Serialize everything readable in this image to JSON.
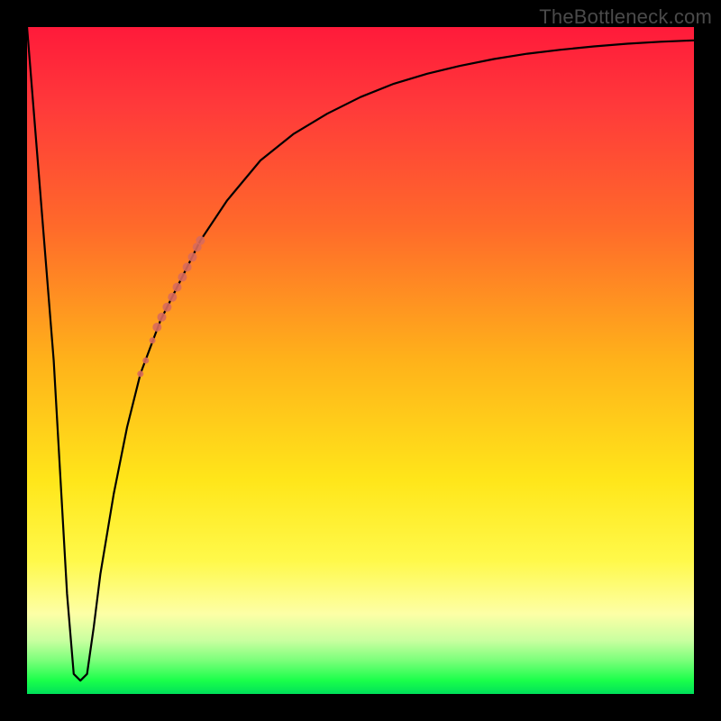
{
  "watermark": "TheBottleneck.com",
  "chart_data": {
    "type": "line",
    "title": "",
    "xlabel": "",
    "ylabel": "",
    "xlim": [
      0,
      100
    ],
    "ylim": [
      0,
      100
    ],
    "grid": false,
    "legend": false,
    "series": [
      {
        "name": "bottleneck-curve",
        "x": [
          0,
          4,
          6,
          7,
          8,
          9,
          10,
          11,
          13,
          15,
          17,
          20,
          23,
          26,
          30,
          35,
          40,
          45,
          50,
          55,
          60,
          65,
          70,
          75,
          80,
          85,
          90,
          95,
          100
        ],
        "y": [
          100,
          50,
          15,
          3,
          2,
          3,
          10,
          18,
          30,
          40,
          48,
          56,
          62,
          68,
          74,
          80,
          84,
          87,
          89.5,
          91.5,
          93,
          94.2,
          95.2,
          96,
          96.6,
          97.1,
          97.5,
          97.8,
          98
        ]
      }
    ],
    "overlay_points": {
      "name": "highlight-segment",
      "color": "#d86a5c",
      "points": [
        {
          "x": 17.0,
          "y": 48.0,
          "r": 3.5
        },
        {
          "x": 17.8,
          "y": 50.0,
          "r": 3.5
        },
        {
          "x": 18.8,
          "y": 53.0,
          "r": 3.5
        },
        {
          "x": 19.5,
          "y": 55.0,
          "r": 5.0
        },
        {
          "x": 20.2,
          "y": 56.5,
          "r": 5.0
        },
        {
          "x": 21.0,
          "y": 58.0,
          "r": 5.0
        },
        {
          "x": 21.8,
          "y": 59.5,
          "r": 5.0
        },
        {
          "x": 22.5,
          "y": 61.0,
          "r": 5.0
        },
        {
          "x": 23.3,
          "y": 62.5,
          "r": 5.0
        },
        {
          "x": 24.0,
          "y": 64.0,
          "r": 5.0
        },
        {
          "x": 24.8,
          "y": 65.5,
          "r": 5.0
        },
        {
          "x": 25.5,
          "y": 67.0,
          "r": 5.0
        },
        {
          "x": 26.0,
          "y": 68.0,
          "r": 5.0
        }
      ]
    }
  }
}
